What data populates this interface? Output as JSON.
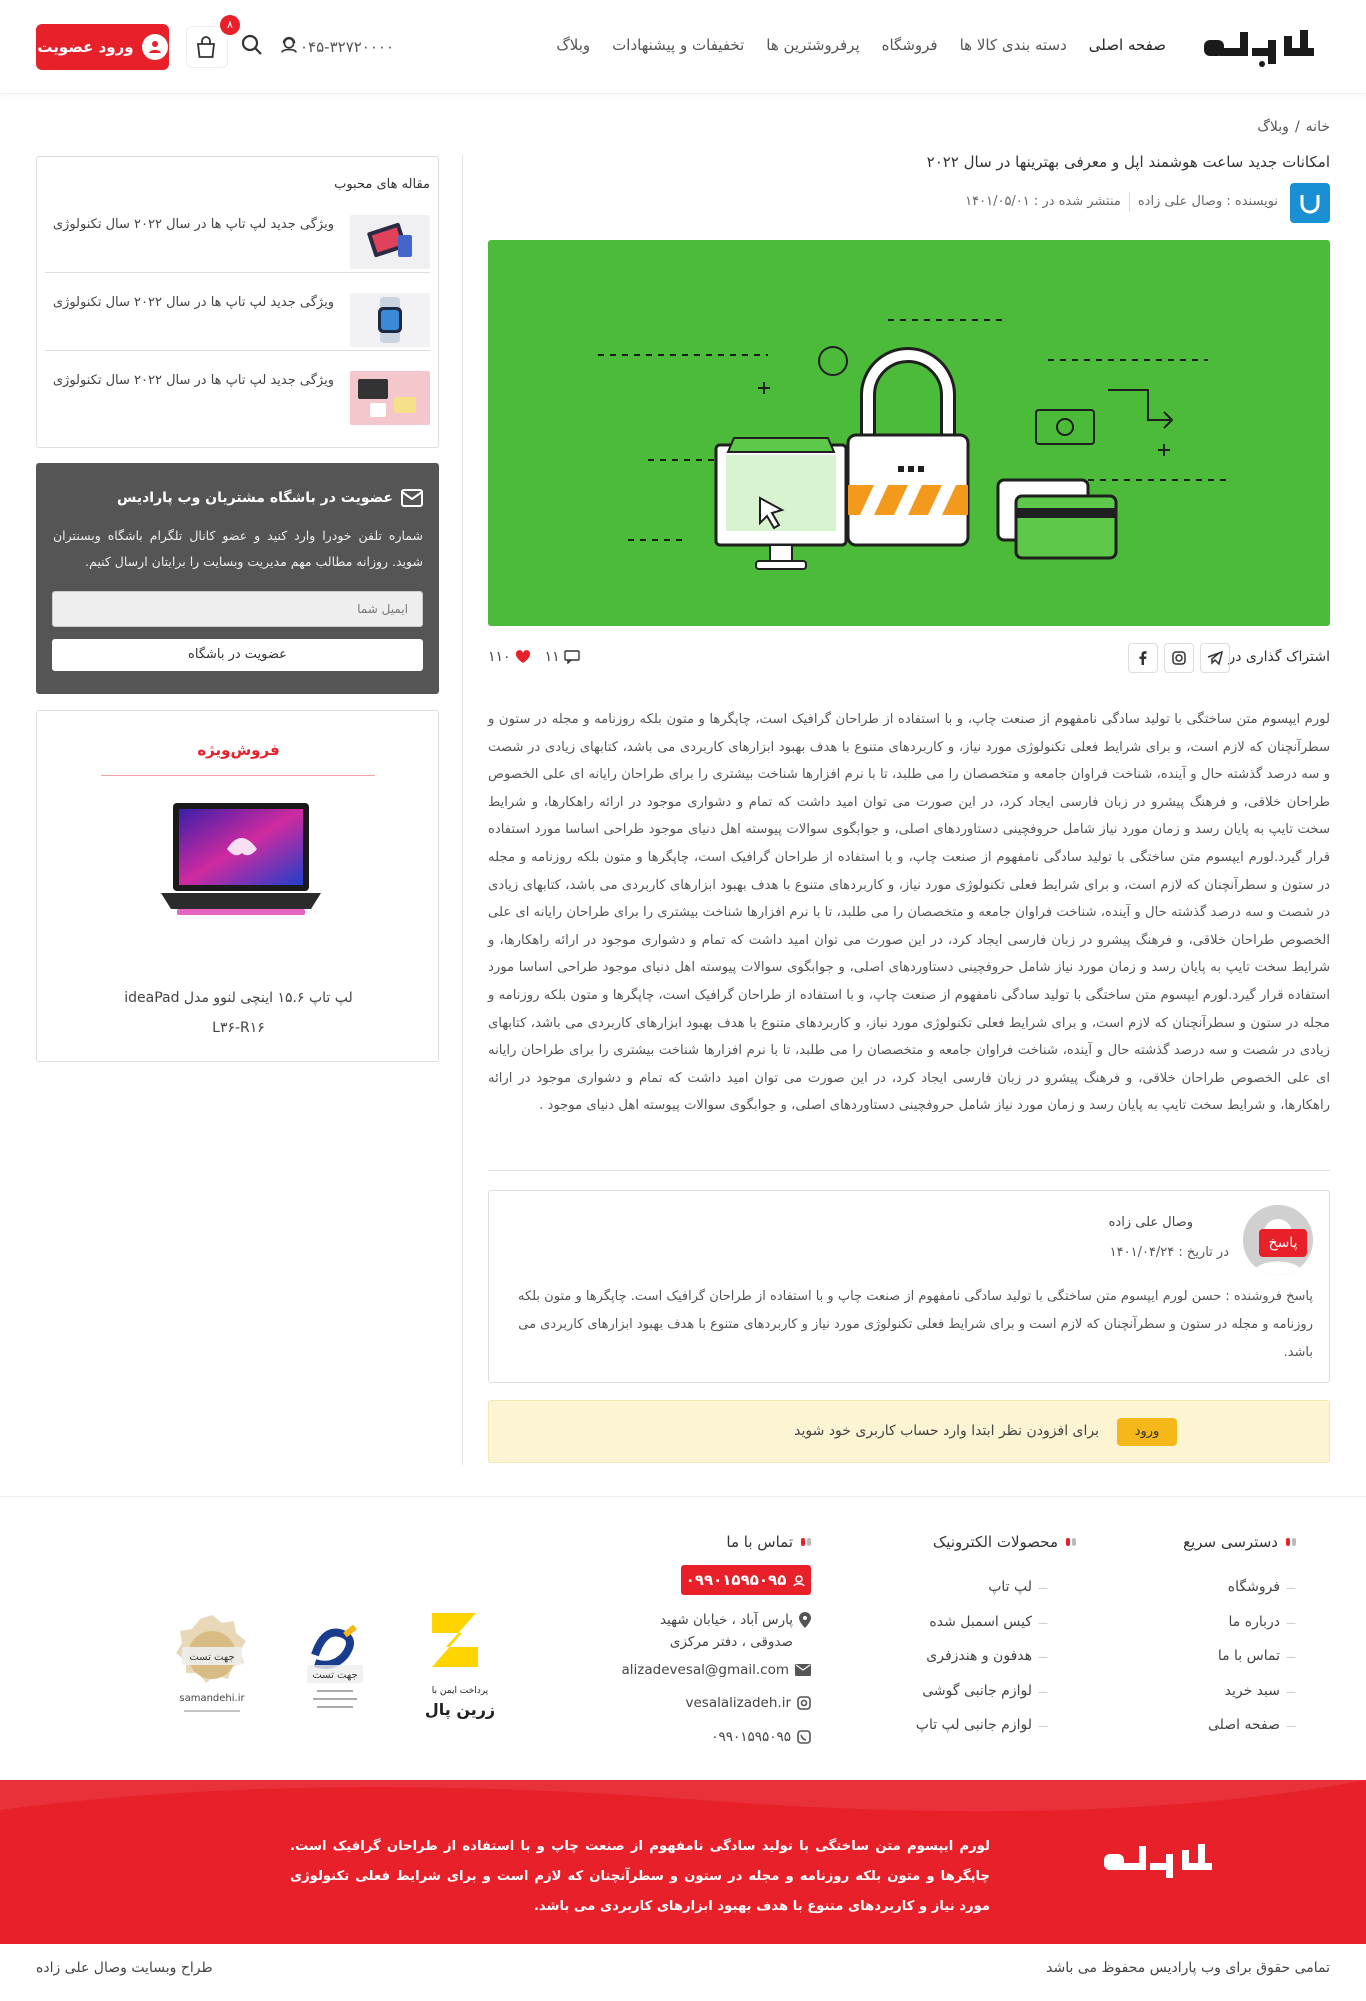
{
  "header": {
    "nav": [
      "صفحه اصلی",
      "دسته بندی کالا ها",
      "فروشگاه",
      "پرفروشترین ها",
      "تخفیفات و پیشنهادات",
      "وبلاگ"
    ],
    "phone": "۰۴۵-۳۲۷۲۰۰۰۰",
    "cart_count": "۸",
    "login_label": "ورود عضویت",
    "brand": "وب پارادایس"
  },
  "breadcrumb": {
    "home": "خانه",
    "sep": "/",
    "current": "وبلاگ"
  },
  "article": {
    "title": "امکانات جدید ساعت هوشمند اپل و معرفی بهترینها در سال ۲۰۲۲",
    "author": "نویسنده : وصال علی زاده",
    "published": "منتشر شده در : ۱۴۰۱/۰۵/۰۱",
    "share_label": "اشتراک گذاری در",
    "likes": "۱۱۰",
    "comments": "۱۱",
    "body": "لورم ایپسوم متن ساختگی با تولید سادگی نامفهوم از صنعت چاپ، و با استفاده از طراحان گرافیک است، چاپگرها و متون بلکه روزنامه و مجله در ستون و سطرآنچنان که لازم است، و برای شرایط فعلی تکنولوژی مورد نیاز، و کاربردهای متنوع با هدف بهبود ابزارهای کاربردی می باشد، کتابهای زیادی در شصت و سه درصد گذشته حال و آینده، شناخت فراوان جامعه و متخصصان را می طلبد، تا با نرم افزارها شناخت بیشتری را برای طراحان رایانه ای علی الخصوص طراحان خلاقی، و فرهنگ پیشرو در زبان فارسی ایجاد کرد، در این صورت می توان امید داشت که تمام و دشواری موجود در ارائه راهکارها، و شرایط سخت تایپ به پایان رسد و زمان مورد نیاز شامل حروفچینی دستاوردهای اصلی، و جوابگوی سوالات پیوسته اهل دنیای موجود طراحی اساسا مورد استفاده قرار گیرد.لورم ایپسوم متن ساختگی با تولید سادگی نامفهوم از صنعت چاپ، و با استفاده از طراحان گرافیک است، چاپگرها و متون بلکه روزنامه و مجله در ستون و سطرآنچنان که لازم است، و برای شرایط فعلی تکنولوژی مورد نیاز، و کاربردهای متنوع با هدف بهبود ابزارهای کاربردی می باشد، کتابهای زیادی در شصت و سه درصد گذشته حال و آینده، شناخت فراوان جامعه و متخصصان را می طلبد، تا با نرم افزارها شناخت بیشتری را برای طراحان رایانه ای علی الخصوص طراحان خلاقی، و فرهنگ پیشرو در زبان فارسی ایجاد کرد، در این صورت می توان امید داشت که تمام و دشواری موجود در ارائه راهکارها، و شرایط سخت تایپ به پایان رسد و زمان مورد نیاز شامل حروفچینی دستاوردهای اصلی، و جوابگوی سوالات پیوسته اهل دنیای موجود طراحی اساسا مورد استفاده قرار گیرد.لورم ایپسوم متن ساختگی با تولید سادگی نامفهوم از صنعت چاپ، و با استفاده از طراحان گرافیک است، چاپگرها و متون بلکه روزنامه و مجله در ستون و سطرآنچنان که لازم است، و برای شرایط فعلی تکنولوژی مورد نیاز، و کاربردهای متنوع با هدف بهبود ابزارهای کاربردی می باشد، کتابهای زیادی در شصت و سه درصد گذشته حال و آینده، شناخت فراوان جامعه و متخصصان را می طلبد، تا با نرم افزارها شناخت بیشتری را برای طراحان رایانه ای علی الخصوص طراحان خلاقی، و فرهنگ پیشرو در زبان فارسی ایجاد کرد، در این صورت می توان امید داشت که تمام و دشواری موجود در ارائه راهکارها، و شرایط سخت تایپ به پایان رسد و زمان مورد نیاز شامل حروفچینی دستاوردهای اصلی، و جوابگوی سوالات پیوسته اهل دنیای موجود ."
  },
  "comment": {
    "name": "وصال علی زاده",
    "date": "در تاریخ : ۱۴۰۱/۰۴/۲۴",
    "reply_label": "پاسخ",
    "text": "پاسخ فروشنده : حسن لورم ایپسوم متن ساختگی با تولید سادگی نامفهوم از صنعت چاپ و با استفاده از طراحان گرافیک است. چاپگرها و متون بلکه روزنامه و مجله در ستون و سطرآنچنان که لازم است و برای شرایط فعلی تکنولوژی مورد نیاز و کاربردهای متنوع با هدف بهبود ابزارهای کاربردی می باشد."
  },
  "login_note": {
    "text": "برای افزودن نظر ابتدا وارد حساب کاربری خود شوید",
    "button": "ورود"
  },
  "sidebar": {
    "popular_title": "مقاله های محبوب",
    "popular_items": [
      "ویژگی جدید لپ تاپ ها در سال ۲۰۲۲ سال تکنولوژی",
      "ویژگی جدید لپ تاپ ها در سال ۲۰۲۲ سال تکنولوژی",
      "ویژگی جدید لپ تاپ ها در سال ۲۰۲۲ سال تکنولوژی"
    ],
    "club_title": "عضویت در باشگاه مشتریان وب پارادیس",
    "club_desc": "شماره تلفن خودرا وارد کنید و عضو کانال تلگرام باشگاه وبسنتران شوید. روزانه مطالب مهم مدیریت وبسایت را برایتان ارسال کنیم.",
    "club_placeholder": "ایمیل شما",
    "club_button": "عضویت در باشگاه",
    "special_title": "فروش‌ویژه",
    "special_product_line1": "لپ تاپ ۱۵.۶ اینچی لنوو مدل ideaPad",
    "special_product_line2": "L۳۶-R۱۶"
  },
  "footer": {
    "col1_title": "دسترسی سریع",
    "col1_items": [
      "فروشگاه",
      "درباره ما",
      "تماس با ما",
      "سبد خرید",
      "صفحه اصلی"
    ],
    "col2_title": "محصولات الکترونیک",
    "col2_items": [
      "لپ تاپ",
      "کیس اسمبل شده",
      "هدفون و هندزفری",
      "لوازم جانبی گوشی",
      "لوازم جانبی لپ تاپ"
    ],
    "col3_title": "تماس با ما",
    "phone": "۰۹۹۰۱۵۹۵۰۹۵",
    "address": "پارس آباد ، خیابان شهید صدوقی ، دفتر مرکزی",
    "email": "alizadevesal@gmail.com",
    "instagram": "vesalalizadeh.ir",
    "whatsapp": "۰۹۹۰۱۵۹۵۰۹۵",
    "badge_test": "جهت تست",
    "samandehi": "samandehi.ir",
    "zarinpal_top": "پرداخت ایمن با",
    "zarinpal_name": "زرین پال",
    "red_text": "لورم ایپسوم متن ساختگی با تولید سادگی نامفهوم از صنعت چاپ و با استفاده از طراحان گرافیک است. چاپگرها و متون بلکه روزنامه و مجله در ستون و سطرآنچنان که لازم است و برای شرایط فعلی تکنولوژی مورد نیاز و کاربردهای متنوع با هدف بهبود ابزارهای کاربردی می باشد.",
    "copyright": "تمامی حقوق برای وب پارادیس محفوظ می باشد",
    "designer": "طراح وبسایت وصال علی زاده"
  },
  "colors": {
    "accent": "#e8202a",
    "hero_green": "#4cbb3a",
    "club_bg": "#555555",
    "note_bg": "#fdf4d3",
    "note_btn": "#f5b818"
  }
}
